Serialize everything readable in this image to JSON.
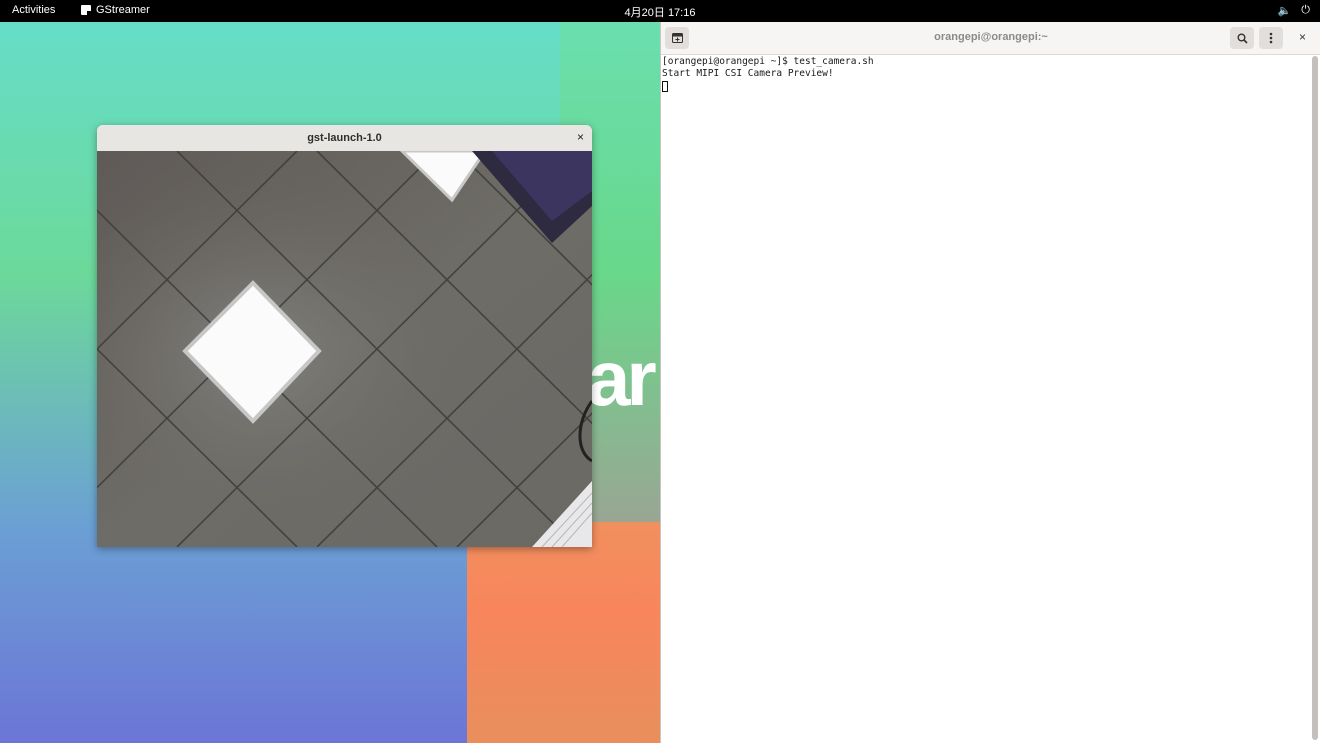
{
  "topbar": {
    "activities": "Activities",
    "app_name": "GStreamer",
    "clock": "4月20日 17:16",
    "volume_glyph": "🔈",
    "power_glyph": "⏻"
  },
  "wallpaper": {
    "text": "ar"
  },
  "gst_window": {
    "title": "gst-launch-1.0",
    "close_glyph": "×"
  },
  "terminal": {
    "title": "orangepi@orangepi:~",
    "close_glyph": "×",
    "lines": [
      "[orangepi@orangepi ~]$ test_camera.sh",
      "Start MIPI CSI Camera Preview!"
    ]
  },
  "colors": {
    "topbar_bg": "#000000",
    "terminal_bg": "#ffffff",
    "wallpaper_teal": "#66ddc8",
    "wallpaper_purple": "#6c75d6",
    "wallpaper_orange": "#f8855c"
  },
  "icons": {
    "new_tab": "new-tab-icon",
    "search": "search-icon",
    "menu": "kebab-menu-icon",
    "close": "close-icon",
    "volume": "volume-icon",
    "power": "power-icon"
  }
}
